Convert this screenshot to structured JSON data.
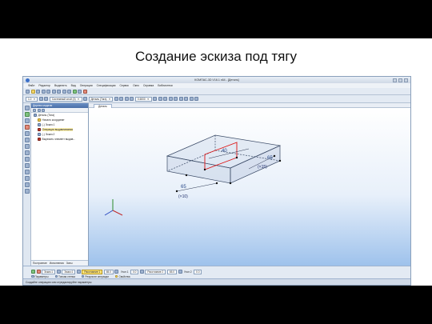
{
  "slide": {
    "title": "Создание эскиза под тягу"
  },
  "window": {
    "title": "КОМПАС-3D V16.1 x64 - [Деталь]"
  },
  "menu": [
    "Файл",
    "Редактор",
    "Выделить",
    "Вид",
    "Операции",
    "Спецификация",
    "Сервис",
    "Окно",
    "Справка",
    "Библиотеки"
  ],
  "toolbar": {
    "scale_value": "1.0",
    "style_value": "Системный слой (0)",
    "detail_value": "Деталь (Тяга)",
    "zoom_value": "0.6000"
  },
  "document": {
    "tab_label": "Деталь"
  },
  "tree": {
    "header": "Дерево модели",
    "nodes": [
      {
        "label": "Деталь (Тяга)",
        "level": 0,
        "icon": "detail-icon"
      },
      {
        "label": "Начало координат",
        "level": 1,
        "icon": "origin-icon"
      },
      {
        "label": "(-) Эскиз:1",
        "level": 1,
        "icon": "sketch-icon"
      },
      {
        "label": "Операция выдавливания",
        "level": 1,
        "icon": "extrude-icon"
      },
      {
        "label": "(-) Эскиз:2",
        "level": 1,
        "icon": "sketch-icon"
      },
      {
        "label": "Вырезать элемент выдав...",
        "level": 1,
        "icon": "cut-extrude-icon"
      }
    ],
    "bottom_tabs": [
      "Построение",
      "Исполнения",
      "Зоны"
    ]
  },
  "dimensions": {
    "d1": "65",
    "d2": "40",
    "d3": "65",
    "note_left": "(×10)",
    "note_right": "(×15)"
  },
  "properties": {
    "row": [
      {
        "label": "Эскиз:1",
        "highlight": false
      },
      {
        "label": "Эскиз:1",
        "highlight": false
      }
    ],
    "distance1_label": "Расстояние 1",
    "distance1_value": "65.0",
    "angle1_label": "Угол 1",
    "angle1_value": "0.0",
    "distance2_label": "Расстояние 2",
    "distance2_value": "65.0",
    "angle2_label": "Угол 2",
    "angle2_value": "0.0",
    "tabs": [
      "Параметры",
      "Тонкая стенка",
      "Результат операции",
      "Свойства"
    ]
  },
  "status": {
    "text": "Создайте операцию или отредактируйте параметры"
  },
  "colors": {
    "accent": "#4a6fa8",
    "highlight": "#ffe57a",
    "viewport_bottom": "#9ec2ec"
  }
}
